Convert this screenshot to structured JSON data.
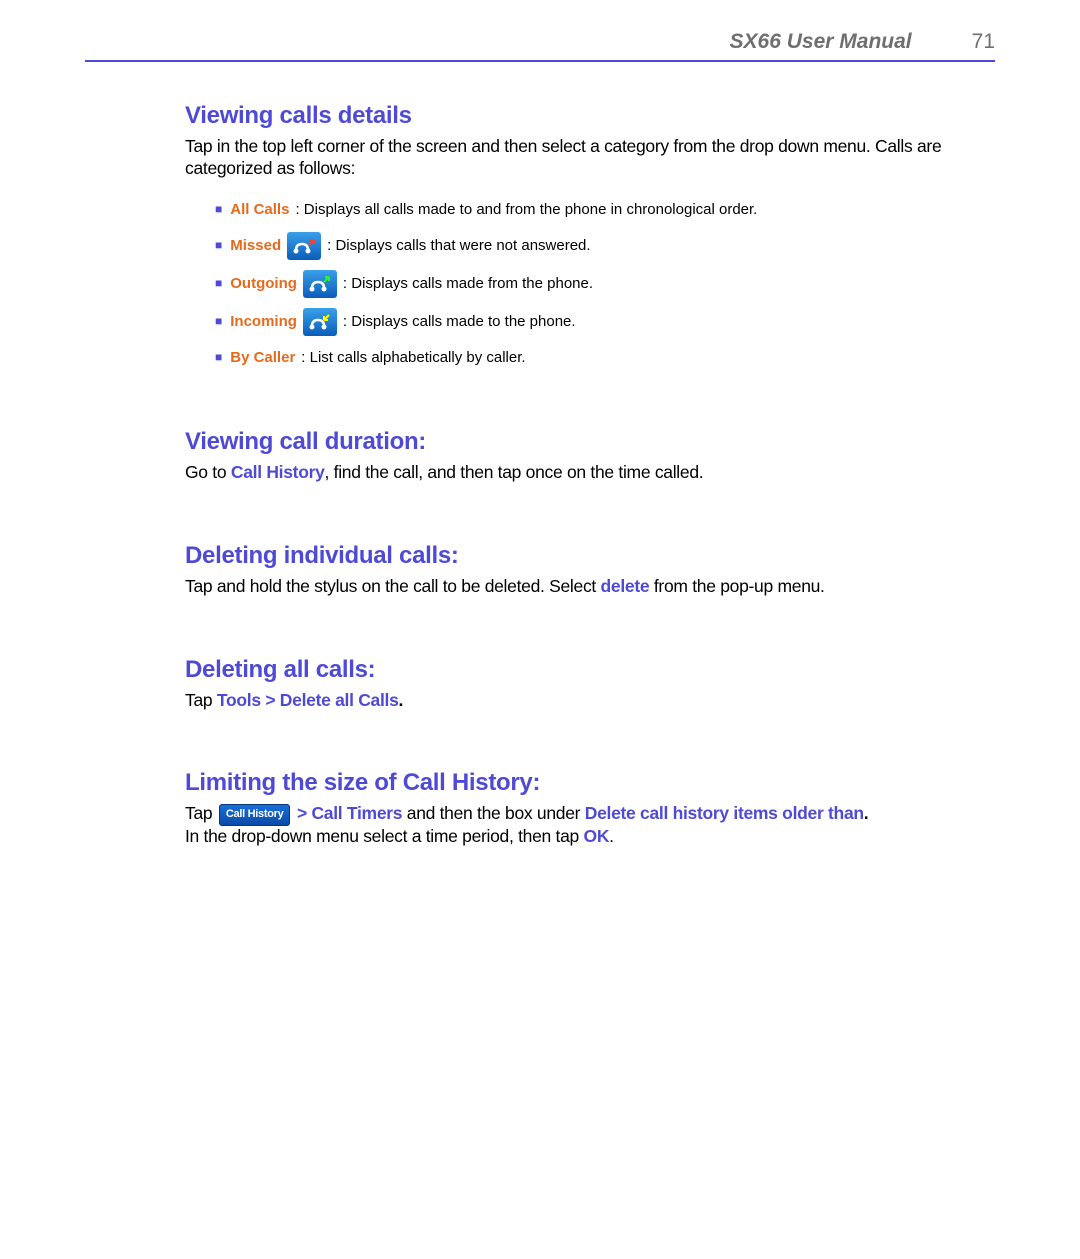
{
  "header": {
    "doc_title": "SX66 User Manual",
    "page_number": "71"
  },
  "sections": {
    "viewing_details": {
      "heading": "Viewing calls details",
      "intro": "Tap in the top left corner of the screen and then select a category from the drop down menu. Calls are categorized as follows:",
      "categories": [
        {
          "label": "All Calls",
          "desc": ": Displays all calls made to and from the phone in chronological order.",
          "icon": null
        },
        {
          "label": "Missed",
          "desc": ": Displays calls that were not answered.",
          "icon": "missed"
        },
        {
          "label": "Outgoing",
          "desc": ": Displays calls made from the phone.",
          "icon": "outgoing"
        },
        {
          "label": "Incoming",
          "desc": ": Displays calls made to the phone.",
          "icon": "incoming"
        },
        {
          "label": "By Caller",
          "desc": ": List calls alphabetically by caller.",
          "icon": null
        }
      ]
    },
    "viewing_duration": {
      "heading": "Viewing call duration:",
      "text_pre": "Go to ",
      "link1": "Call History",
      "text_post": ", find the call, and then tap once on the time called."
    },
    "deleting_individual": {
      "heading": "Deleting individual calls:",
      "text_pre": "Tap and hold the stylus on the call to be deleted. Select ",
      "bold": "delete",
      "text_post": " from the pop-up menu."
    },
    "deleting_all": {
      "heading": "Deleting all calls:",
      "text_pre": "Tap ",
      "link1": "Tools > Delete all Calls",
      "text_post": "."
    },
    "limiting": {
      "heading": "Limiting the size of Call History:",
      "line1_pre": "Tap ",
      "btn_label": "Call History",
      "line1_mid1": " > Call Timers",
      "line1_mid2": " and then the box under ",
      "line1_link2": "Delete call history items older than",
      "line1_post": ".",
      "line2_pre": "In the drop-down menu select a time period, then tap ",
      "line2_bold": "OK",
      "line2_post": "."
    }
  }
}
